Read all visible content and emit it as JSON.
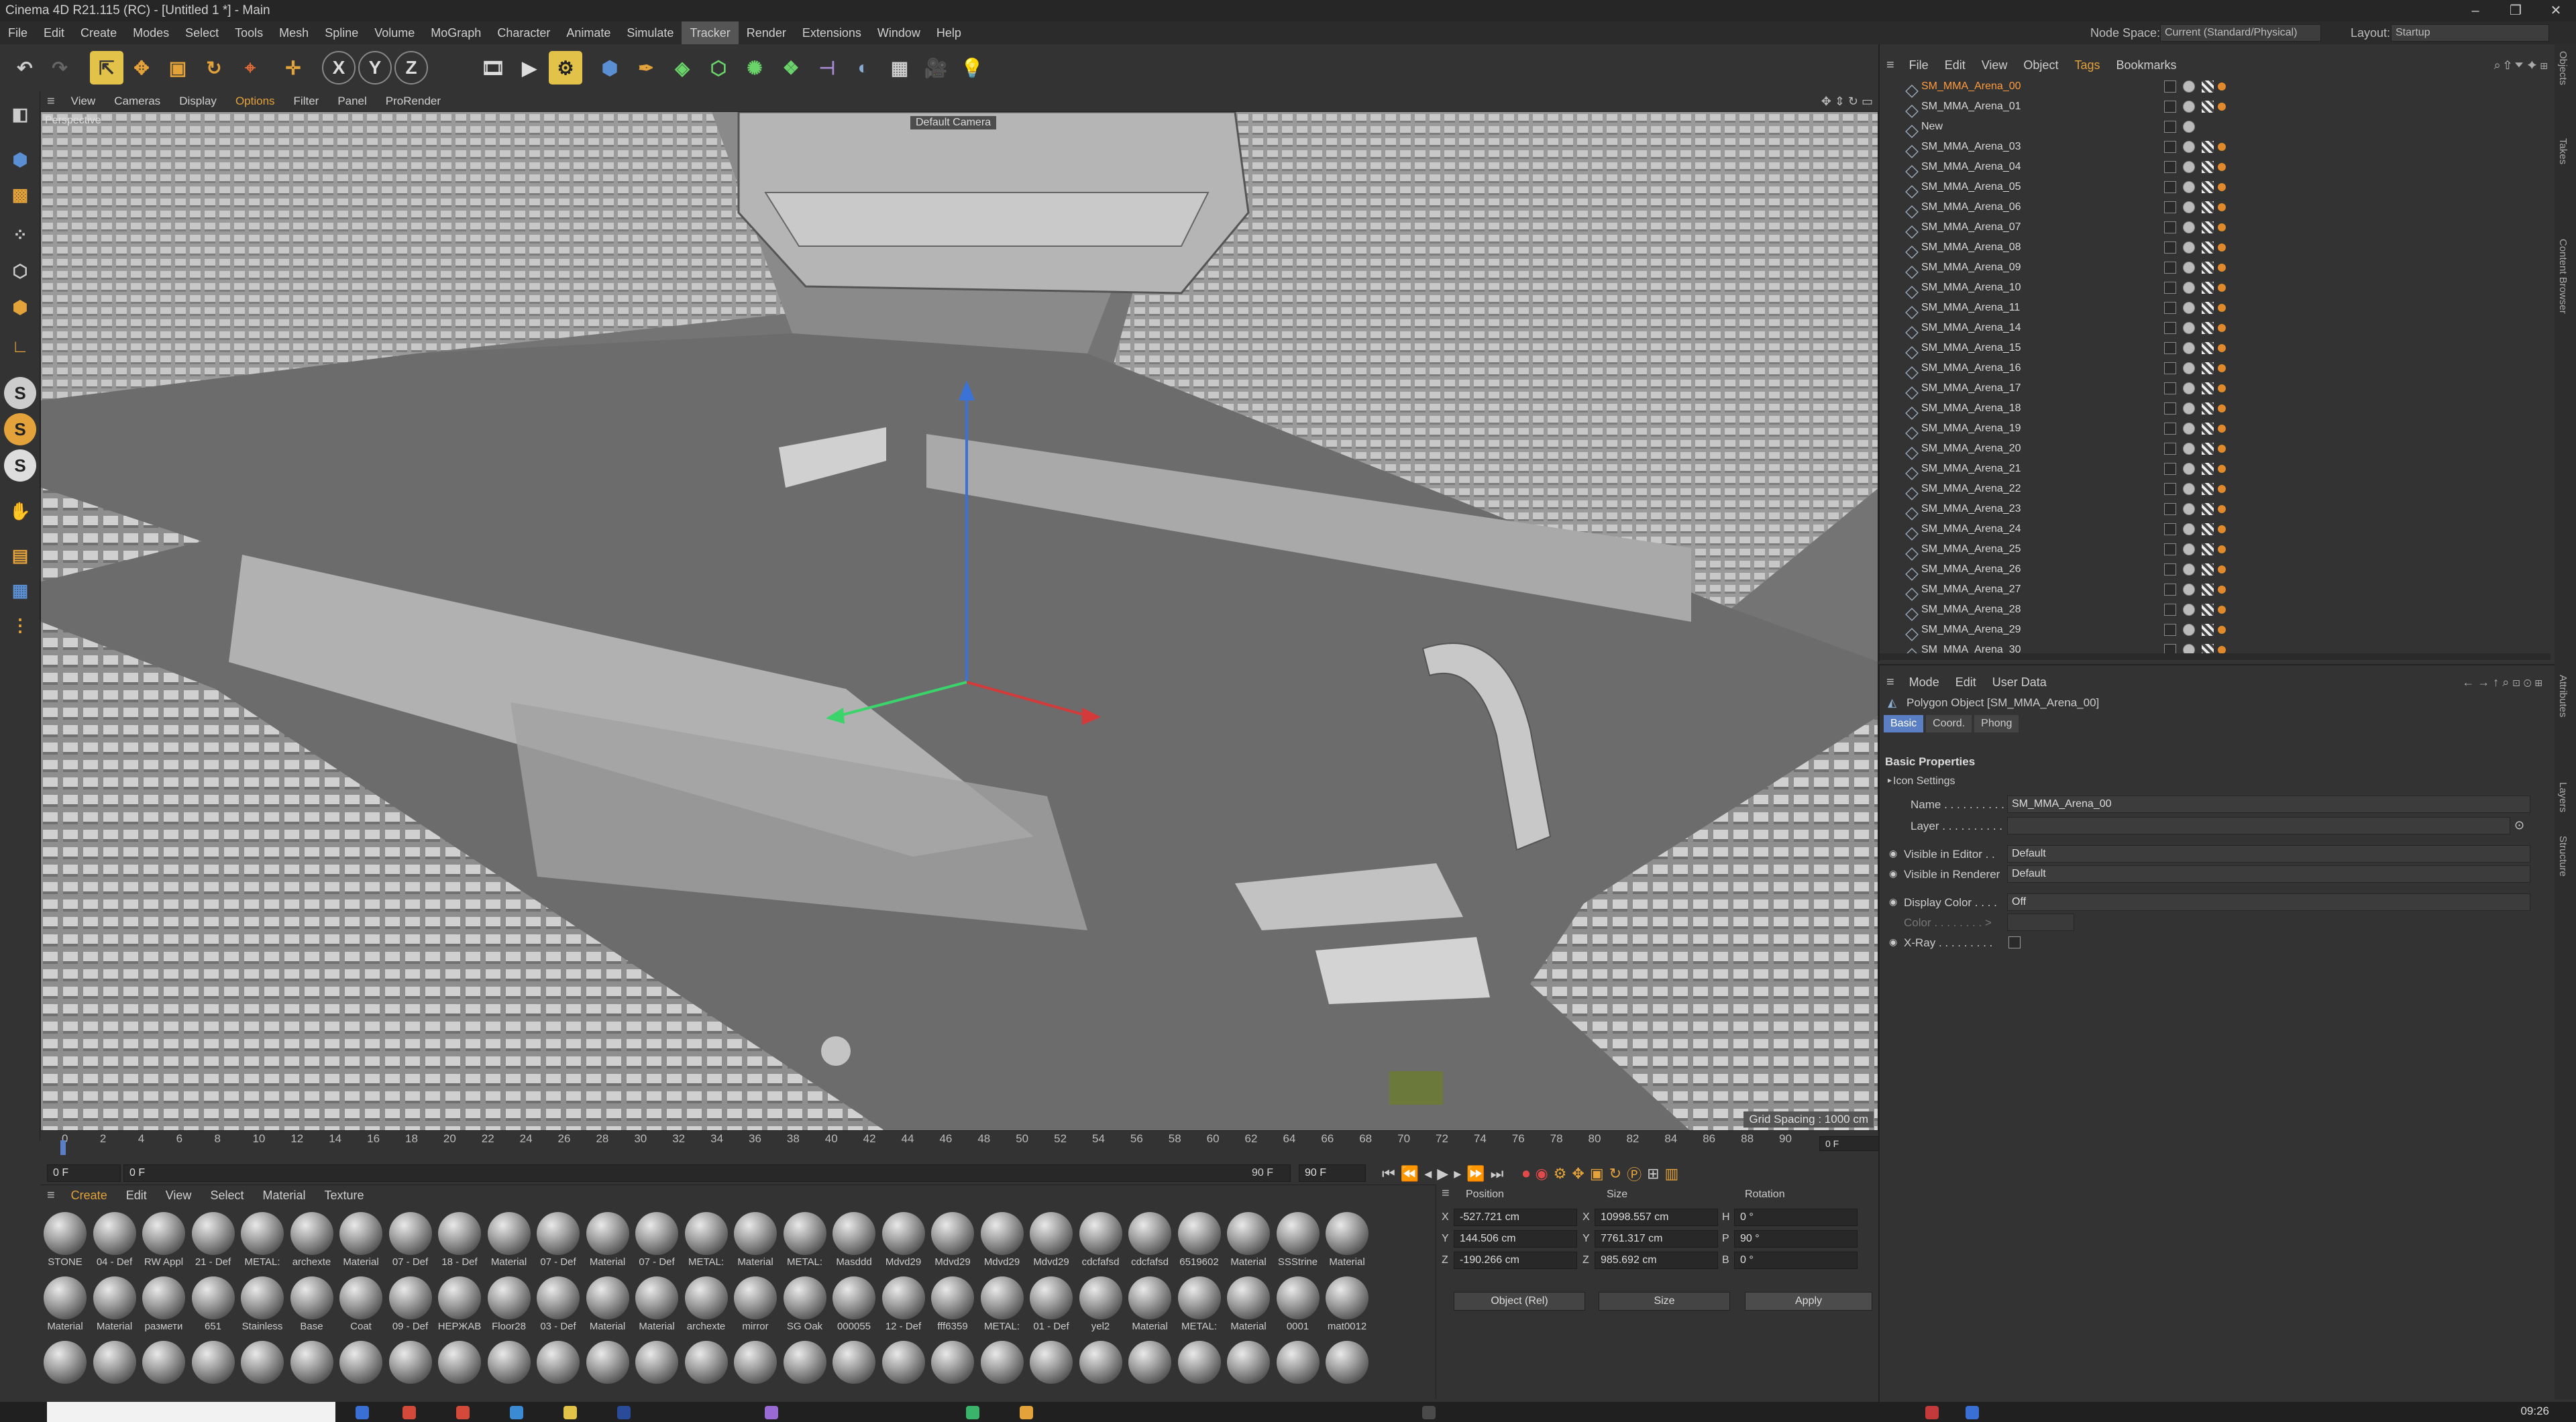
{
  "window": {
    "title": "Cinema 4D R21.115 (RC) - [Untitled 1 *] - Main",
    "controls": [
      "–",
      "❐",
      "✕"
    ]
  },
  "menubar": {
    "items": [
      "File",
      "Edit",
      "Create",
      "Modes",
      "Select",
      "Tools",
      "Mesh",
      "Spline",
      "Volume",
      "MoGraph",
      "Character",
      "Animate",
      "Simulate",
      "Tracker",
      "Render",
      "Extensions",
      "Window",
      "Help"
    ],
    "active": "Tracker",
    "node_space_label": "Node Space:",
    "node_space_value": "Current (Standard/Physical)",
    "layout_label": "Layout:",
    "layout_value": "Startup"
  },
  "toolbar": {
    "axis_x": "X",
    "axis_y": "Y",
    "axis_z": "Z"
  },
  "viewport": {
    "menu": [
      "View",
      "Cameras",
      "Display",
      "Options",
      "Filter",
      "Panel",
      "ProRender"
    ],
    "active_menu": "Options",
    "projection": "Perspective",
    "camera": "Default Camera",
    "grid_spacing": "Grid Spacing : 1000 cm"
  },
  "timeline": {
    "ticks": [
      "0",
      "2",
      "4",
      "6",
      "8",
      "10",
      "12",
      "14",
      "16",
      "18",
      "20",
      "22",
      "24",
      "26",
      "28",
      "30",
      "32",
      "34",
      "36",
      "38",
      "40",
      "42",
      "44",
      "46",
      "48",
      "50",
      "52",
      "54",
      "56",
      "58",
      "60",
      "62",
      "64",
      "66",
      "68",
      "70",
      "72",
      "74",
      "76",
      "78",
      "80",
      "82",
      "84",
      "86",
      "88",
      "90"
    ],
    "current_frame_field": "0 F",
    "start_field": "0 F",
    "start_field2": "0 F",
    "end_field": "90 F",
    "end_field2": "90 F",
    "frame_display": "0 F"
  },
  "materials": {
    "menu": [
      "Create",
      "Edit",
      "View",
      "Select",
      "Material",
      "Texture"
    ],
    "row1": [
      "STONE",
      "04 - Def",
      "RW Appl",
      "21 - Def",
      "METAL:",
      "archexte",
      "Material",
      "07 - Def",
      "18 - Def",
      "Material",
      "07 - Def",
      "Material",
      "07 - Def",
      "METAL:",
      "Material",
      "METAL:",
      "Masddd",
      "Mdvd29",
      "Mdvd29",
      "Mdvd29",
      "Mdvd29",
      "cdcfafsd",
      "cdcfafsd",
      "6519602",
      "Material",
      "SSStrine",
      "Material"
    ],
    "row2": [
      "Material",
      "Material",
      "размети",
      "651",
      "Stainless",
      "Base",
      "Coat",
      "09 - Def",
      "НЕРЖАВ",
      "Floor28",
      "03 - Def",
      "Material",
      "Material",
      "archexte",
      "mirror",
      "SG Oak",
      "000055",
      "12 - Def",
      "fff6359",
      "METAL:",
      "01 - Def",
      "yel2",
      "Material",
      "METAL:",
      "Material",
      "0001",
      "mat0012"
    ],
    "row3_count": 27
  },
  "coordinates": {
    "headers": {
      "position": "Position",
      "size": "Size",
      "rotation": "Rotation"
    },
    "position": [
      {
        "axis": "X",
        "value": "-527.721 cm"
      },
      {
        "axis": "Y",
        "value": "144.506 cm"
      },
      {
        "axis": "Z",
        "value": "-190.266 cm"
      }
    ],
    "size": [
      {
        "axis": "X",
        "value": "10998.557 cm"
      },
      {
        "axis": "Y",
        "value": "7761.317 cm"
      },
      {
        "axis": "Z",
        "value": "985.692 cm"
      }
    ],
    "rotation": [
      {
        "axis": "H",
        "value": "0 °"
      },
      {
        "axis": "P",
        "value": "90 °"
      },
      {
        "axis": "B",
        "value": "0 °"
      }
    ],
    "mode_dropdown": "Object (Rel)",
    "size_dropdown": "Size",
    "apply_label": "Apply"
  },
  "object_manager": {
    "menu": [
      "File",
      "Edit",
      "View",
      "Object",
      "Tags",
      "Bookmarks"
    ],
    "active_menu": "Tags",
    "objects": [
      {
        "name": "SM_MMA_Arena_00",
        "selected": true
      },
      {
        "name": "SM_MMA_Arena_01",
        "selected": false
      },
      {
        "name": "New",
        "selected": false
      },
      {
        "name": "SM_MMA_Arena_03",
        "selected": false
      },
      {
        "name": "SM_MMA_Arena_04",
        "selected": false
      },
      {
        "name": "SM_MMA_Arena_05",
        "selected": false
      },
      {
        "name": "SM_MMA_Arena_06",
        "selected": false
      },
      {
        "name": "SM_MMA_Arena_07",
        "selected": false
      },
      {
        "name": "SM_MMA_Arena_08",
        "selected": false
      },
      {
        "name": "SM_MMA_Arena_09",
        "selected": false
      },
      {
        "name": "SM_MMA_Arena_10",
        "selected": false
      },
      {
        "name": "SM_MMA_Arena_11",
        "selected": false
      },
      {
        "name": "SM_MMA_Arena_14",
        "selected": false
      },
      {
        "name": "SM_MMA_Arena_15",
        "selected": false
      },
      {
        "name": "SM_MMA_Arena_16",
        "selected": false
      },
      {
        "name": "SM_MMA_Arena_17",
        "selected": false
      },
      {
        "name": "SM_MMA_Arena_18",
        "selected": false
      },
      {
        "name": "SM_MMA_Arena_19",
        "selected": false
      },
      {
        "name": "SM_MMA_Arena_20",
        "selected": false
      },
      {
        "name": "SM_MMA_Arena_21",
        "selected": false
      },
      {
        "name": "SM_MMA_Arena_22",
        "selected": false
      },
      {
        "name": "SM_MMA_Arena_23",
        "selected": false
      },
      {
        "name": "SM_MMA_Arena_24",
        "selected": false
      },
      {
        "name": "SM_MMA_Arena_25",
        "selected": false
      },
      {
        "name": "SM_MMA_Arena_26",
        "selected": false
      },
      {
        "name": "SM_MMA_Arena_27",
        "selected": false
      },
      {
        "name": "SM_MMA_Arena_28",
        "selected": false
      },
      {
        "name": "SM_MMA_Arena_29",
        "selected": false
      },
      {
        "name": "SM_MMA_Arena_30",
        "selected": false
      }
    ]
  },
  "attributes": {
    "menu": [
      "Mode",
      "Edit",
      "User Data"
    ],
    "object_title": "Polygon Object [SM_MMA_Arena_00]",
    "tabs": [
      "Basic",
      "Coord.",
      "Phong"
    ],
    "active_tab": "Basic",
    "section": "Basic Properties",
    "icon_settings": "Icon Settings",
    "name_label": "Name . . . . . . . . . .",
    "name_value": "SM_MMA_Arena_00",
    "layer_label": "Layer . . . . . . . . . .",
    "visible_editor_label": "Visible in Editor . .",
    "visible_editor_value": "Default",
    "visible_renderer_label": "Visible in Renderer",
    "visible_renderer_value": "Default",
    "display_color_label": "Display Color . . . .",
    "display_color_value": "Off",
    "color_label": "Color . . . . . . . . >",
    "xray_label": "X-Ray . . . . . . . . ."
  },
  "side_tabs": [
    "Objects",
    "Takes",
    "Content Browser",
    "Attributes",
    "Layers",
    "Structure"
  ],
  "taskbar": {
    "clock": "09:26"
  },
  "colors": {
    "selection": "#ff9a3c",
    "accent_blue": "#5b7fc4",
    "active_tool": "#e3c24a"
  }
}
